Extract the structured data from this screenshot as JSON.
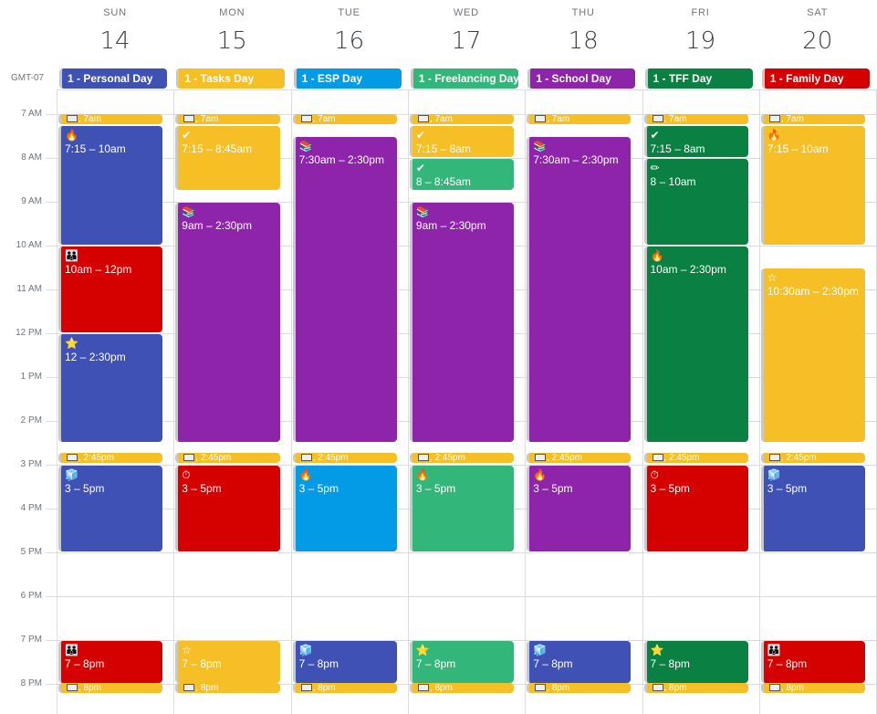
{
  "timezone": "GMT-07",
  "colors": {
    "blue": "#3f51b5",
    "yellow": "#f6bf26",
    "cyan": "#039be5",
    "sage": "#33b679",
    "purple": "#8e24aa",
    "green": "#0b8043",
    "red": "#d50000"
  },
  "days": [
    {
      "dow": "SUN",
      "date": "14",
      "allday": "1 - Personal Day",
      "allday_color": "blue"
    },
    {
      "dow": "MON",
      "date": "15",
      "allday": "1 - Tasks Day",
      "allday_color": "yellow"
    },
    {
      "dow": "TUE",
      "date": "16",
      "allday": "1 - ESP Day",
      "allday_color": "cyan"
    },
    {
      "dow": "WED",
      "date": "17",
      "allday": "1 - Freelancing Day",
      "allday_color": "sage"
    },
    {
      "dow": "THU",
      "date": "18",
      "allday": "1 - School Day",
      "allday_color": "purple"
    },
    {
      "dow": "FRI",
      "date": "19",
      "allday": "1 - TFF Day",
      "allday_color": "green"
    },
    {
      "dow": "SAT",
      "date": "20",
      "allday": "1 - Family Day",
      "allday_color": "red"
    }
  ],
  "hours": [
    "7 AM",
    "8 AM",
    "9 AM",
    "10 AM",
    "11 AM",
    "12 PM",
    "1 PM",
    "2 PM",
    "3 PM",
    "4 PM",
    "5 PM",
    "6 PM",
    "7 PM",
    "8 PM"
  ],
  "reminders": [
    {
      "time": ", 7am",
      "start": 7.0
    },
    {
      "time": ", 2:45pm",
      "start": 14.75
    },
    {
      "time": ", 8pm",
      "start": 20.0
    }
  ],
  "events": [
    {
      "day": 0,
      "start": 7.25,
      "end": 10,
      "label": "7:15 – 10am",
      "icon": "fire-icon",
      "glyph": "🔥",
      "color": "blue"
    },
    {
      "day": 0,
      "start": 10,
      "end": 12,
      "label": "10am – 12pm",
      "icon": "family-icon",
      "glyph": "👪",
      "color": "red"
    },
    {
      "day": 0,
      "start": 12,
      "end": 14.5,
      "label": "12 – 2:30pm",
      "icon": "star-icon",
      "glyph": "⭐",
      "color": "blue"
    },
    {
      "day": 0,
      "start": 15,
      "end": 17,
      "label": "3 – 5pm",
      "icon": "ice-icon",
      "glyph": "🧊",
      "color": "blue"
    },
    {
      "day": 0,
      "start": 19,
      "end": 20,
      "label": "7 – 8pm",
      "icon": "family-icon",
      "glyph": "👪",
      "color": "red"
    },
    {
      "day": 1,
      "start": 7.25,
      "end": 8.75,
      "label": "7:15 – 8:45am",
      "icon": "check-icon",
      "glyph": "✔",
      "color": "yellow"
    },
    {
      "day": 1,
      "start": 9,
      "end": 14.5,
      "label": "9am – 2:30pm",
      "icon": "books-icon",
      "glyph": "📚",
      "color": "purple"
    },
    {
      "day": 1,
      "start": 15,
      "end": 17,
      "label": "3 – 5pm",
      "icon": "stopwatch-icon",
      "glyph": "⏱",
      "color": "red"
    },
    {
      "day": 1,
      "start": 19,
      "end": 20,
      "label": "7 – 8pm",
      "icon": "star-outline-icon",
      "glyph": "☆",
      "color": "yellow"
    },
    {
      "day": 2,
      "start": 7.5,
      "end": 14.5,
      "label": "7:30am – 2:30pm",
      "icon": "books-icon",
      "glyph": "📚",
      "color": "purple"
    },
    {
      "day": 2,
      "start": 15,
      "end": 17,
      "label": "3 – 5pm",
      "icon": "fire-icon",
      "glyph": "🔥",
      "color": "cyan"
    },
    {
      "day": 2,
      "start": 19,
      "end": 20,
      "label": "7 – 8pm",
      "icon": "ice-icon",
      "glyph": "🧊",
      "color": "blue"
    },
    {
      "day": 3,
      "start": 7.25,
      "end": 8,
      "label": "7:15 – 8am",
      "icon": "check-icon",
      "glyph": "✔",
      "color": "yellow"
    },
    {
      "day": 3,
      "start": 8,
      "end": 8.75,
      "label": "8 – 8:45am",
      "icon": "check-icon",
      "glyph": "✔",
      "color": "sage"
    },
    {
      "day": 3,
      "start": 9,
      "end": 14.5,
      "label": "9am – 2:30pm",
      "icon": "books-icon",
      "glyph": "📚",
      "color": "purple"
    },
    {
      "day": 3,
      "start": 15,
      "end": 17,
      "label": "3 – 5pm",
      "icon": "fire-icon",
      "glyph": "🔥",
      "color": "sage"
    },
    {
      "day": 3,
      "start": 19,
      "end": 20,
      "label": "7 – 8pm",
      "icon": "star-icon",
      "glyph": "⭐",
      "color": "sage"
    },
    {
      "day": 4,
      "start": 7.5,
      "end": 14.5,
      "label": "7:30am – 2:30pm",
      "icon": "books-icon",
      "glyph": "📚",
      "color": "purple"
    },
    {
      "day": 4,
      "start": 15,
      "end": 17,
      "label": "3 – 5pm",
      "icon": "fire-icon",
      "glyph": "🔥",
      "color": "purple"
    },
    {
      "day": 4,
      "start": 19,
      "end": 20,
      "label": "7 – 8pm",
      "icon": "ice-icon",
      "glyph": "🧊",
      "color": "blue"
    },
    {
      "day": 5,
      "start": 7.25,
      "end": 8,
      "label": "7:15 – 8am",
      "icon": "check-icon",
      "glyph": "✔",
      "color": "green"
    },
    {
      "day": 5,
      "start": 8,
      "end": 10,
      "label": "8 – 10am",
      "icon": "pencil-icon",
      "glyph": "✏",
      "color": "green"
    },
    {
      "day": 5,
      "start": 10,
      "end": 14.5,
      "label": "10am – 2:30pm",
      "icon": "fire-icon",
      "glyph": "🔥",
      "color": "green"
    },
    {
      "day": 5,
      "start": 15,
      "end": 17,
      "label": "3 – 5pm",
      "icon": "stopwatch-icon",
      "glyph": "⏱",
      "color": "red"
    },
    {
      "day": 5,
      "start": 19,
      "end": 20,
      "label": "7 – 8pm",
      "icon": "star-icon",
      "glyph": "⭐",
      "color": "green"
    },
    {
      "day": 6,
      "start": 7.25,
      "end": 10,
      "label": "7:15 – 10am",
      "icon": "fire-icon",
      "glyph": "🔥",
      "color": "yellow"
    },
    {
      "day": 6,
      "start": 10.5,
      "end": 14.5,
      "label": "10:30am – 2:30pm",
      "icon": "star-outline-icon",
      "glyph": "☆",
      "color": "yellow"
    },
    {
      "day": 6,
      "start": 15,
      "end": 17,
      "label": "3 – 5pm",
      "icon": "ice-icon",
      "glyph": "🧊",
      "color": "blue"
    },
    {
      "day": 6,
      "start": 19,
      "end": 20,
      "label": "7 – 8pm",
      "icon": "family-icon",
      "glyph": "👪",
      "color": "red"
    }
  ]
}
